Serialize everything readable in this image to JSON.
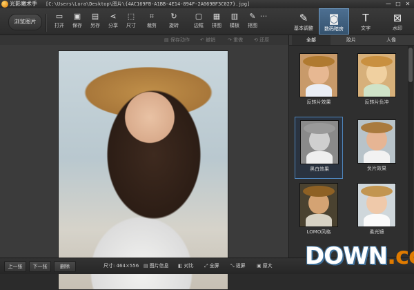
{
  "title_bar": {
    "app_name": "光影魔术手",
    "document_path": "[C:\\Users\\Lora\\Desktop\\图片\\{4AC169FB-A1BB-4E14-894F-2A069BF3C027}.jpg]",
    "minimize_glyph": "—",
    "maximize_glyph": "□",
    "close_glyph": "✕"
  },
  "toolbar": {
    "browse_label": "浏览图片",
    "tools": [
      {
        "label": "打开",
        "icon": "open-folder-icon",
        "glyph": "▭"
      },
      {
        "label": "保存",
        "icon": "save-icon",
        "glyph": "▣"
      },
      {
        "label": "另存",
        "icon": "save-as-icon",
        "glyph": "▤"
      },
      {
        "label": "分享",
        "icon": "share-icon",
        "glyph": "⋖"
      },
      {
        "label": "尺寸",
        "icon": "resize-icon",
        "glyph": "⬚"
      },
      {
        "label": "裁剪",
        "icon": "crop-icon",
        "glyph": "⌗"
      },
      {
        "label": "旋转",
        "icon": "rotate-icon",
        "glyph": "↻"
      },
      {
        "label": "边框",
        "icon": "frame-icon",
        "glyph": "▢"
      },
      {
        "label": "拼图",
        "icon": "collage-icon",
        "glyph": "▦"
      },
      {
        "label": "模板",
        "icon": "template-icon",
        "glyph": "▥"
      },
      {
        "label": "抠图",
        "icon": "cutout-icon",
        "glyph": "✎"
      }
    ],
    "more_glyph": "···",
    "right_tabs": [
      {
        "label": "基本调整",
        "icon": "basic-adjust-icon",
        "glyph": "✎",
        "active": false
      },
      {
        "label": "数码暗房",
        "icon": "camera-icon",
        "glyph": "◙",
        "active": true
      },
      {
        "label": "文字",
        "icon": "text-icon",
        "glyph": "T",
        "active": false
      },
      {
        "label": "水印",
        "icon": "watermark-icon",
        "glyph": "⊠",
        "active": false
      }
    ]
  },
  "undo_bar": {
    "save_action": "保存动作",
    "undo": "撤销",
    "redo": "重做",
    "restore": "还原"
  },
  "side_panel": {
    "sub_tabs": [
      "全部",
      "胶片",
      "人像"
    ],
    "active_sub_tab": "全部",
    "effects": [
      {
        "label": "反转片效果",
        "selected": false,
        "tint": "#c89a6a",
        "face": "#e7b892",
        "hat": "#b07a30",
        "dress": "#eaeef5"
      },
      {
        "label": "反转片负冲",
        "selected": false,
        "tint": "#d7b07a",
        "face": "#f0d0a0",
        "hat": "#c99040",
        "dress": "#cfe3c8"
      },
      {
        "label": "黑白效果",
        "selected": true,
        "tint": "#8a8a8a",
        "face": "#cfcfcf",
        "hat": "#9a9a9a",
        "dress": "#efefef"
      },
      {
        "label": "负片效果",
        "selected": false,
        "tint": "#b8c3c9",
        "face": "#e6b594",
        "hat": "#a97a3e",
        "dress": "#f2f2f2"
      },
      {
        "label": "LOMO风格",
        "selected": false,
        "tint": "#4a4230",
        "face": "#d4a373",
        "hat": "#8e6124",
        "dress": "#d7d2c4"
      },
      {
        "label": "柔光镜",
        "selected": false,
        "tint": "#cfd7db",
        "face": "#efc9aa",
        "hat": "#c29550",
        "dress": "#fafafa"
      }
    ]
  },
  "footer": {
    "prev_label": "上一张",
    "next_label": "下一张",
    "delete_label": "删除",
    "size_text": "尺寸: 464×556",
    "image_info": "图片信息",
    "compare": "对比",
    "fullscreen": "全屏",
    "fit_screen": "适屏",
    "original_size": "原大"
  },
  "watermark": {
    "text": "DOWN",
    "dot": ".",
    "tld": "cc"
  },
  "colors": {
    "accent": "#4f86bd",
    "active_tab": "#35536f",
    "watermark_blue": "#3f6f98",
    "watermark_orange": "#e07b00"
  }
}
